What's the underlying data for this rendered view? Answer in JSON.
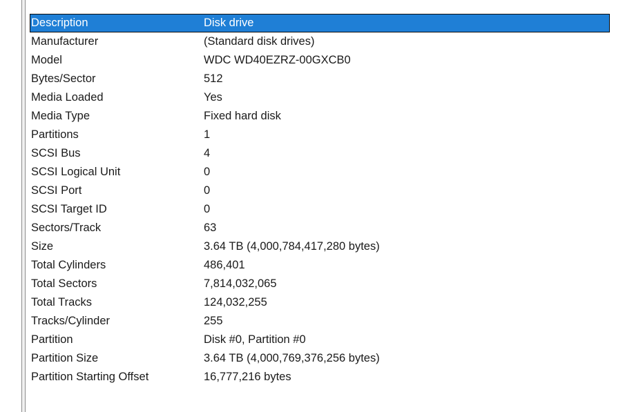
{
  "properties": {
    "rows": [
      {
        "item": "Description",
        "value": "Disk drive"
      },
      {
        "item": "Manufacturer",
        "value": "(Standard disk drives)"
      },
      {
        "item": "Model",
        "value": "WDC WD40EZRZ-00GXCB0"
      },
      {
        "item": "Bytes/Sector",
        "value": "512"
      },
      {
        "item": "Media Loaded",
        "value": "Yes"
      },
      {
        "item": "Media Type",
        "value": "Fixed hard disk"
      },
      {
        "item": "Partitions",
        "value": "1"
      },
      {
        "item": "SCSI Bus",
        "value": "4"
      },
      {
        "item": "SCSI Logical Unit",
        "value": "0"
      },
      {
        "item": "SCSI Port",
        "value": "0"
      },
      {
        "item": "SCSI Target ID",
        "value": "0"
      },
      {
        "item": "Sectors/Track",
        "value": "63"
      },
      {
        "item": "Size",
        "value": "3.64 TB (4,000,784,417,280 bytes)"
      },
      {
        "item": "Total Cylinders",
        "value": "486,401"
      },
      {
        "item": "Total Sectors",
        "value": "7,814,032,065"
      },
      {
        "item": "Total Tracks",
        "value": "124,032,255"
      },
      {
        "item": "Tracks/Cylinder",
        "value": "255"
      },
      {
        "item": "Partition",
        "value": "Disk #0, Partition #0"
      },
      {
        "item": "Partition Size",
        "value": "3.64 TB (4,000,769,376,256 bytes)"
      },
      {
        "item": "Partition Starting Offset",
        "value": "16,777,216 bytes"
      }
    ],
    "selected_index": 0
  },
  "colors": {
    "selection": "#1f7fd6",
    "selection_text": "#ffffff",
    "text": "#1a1a1a",
    "background": "#ffffff"
  }
}
